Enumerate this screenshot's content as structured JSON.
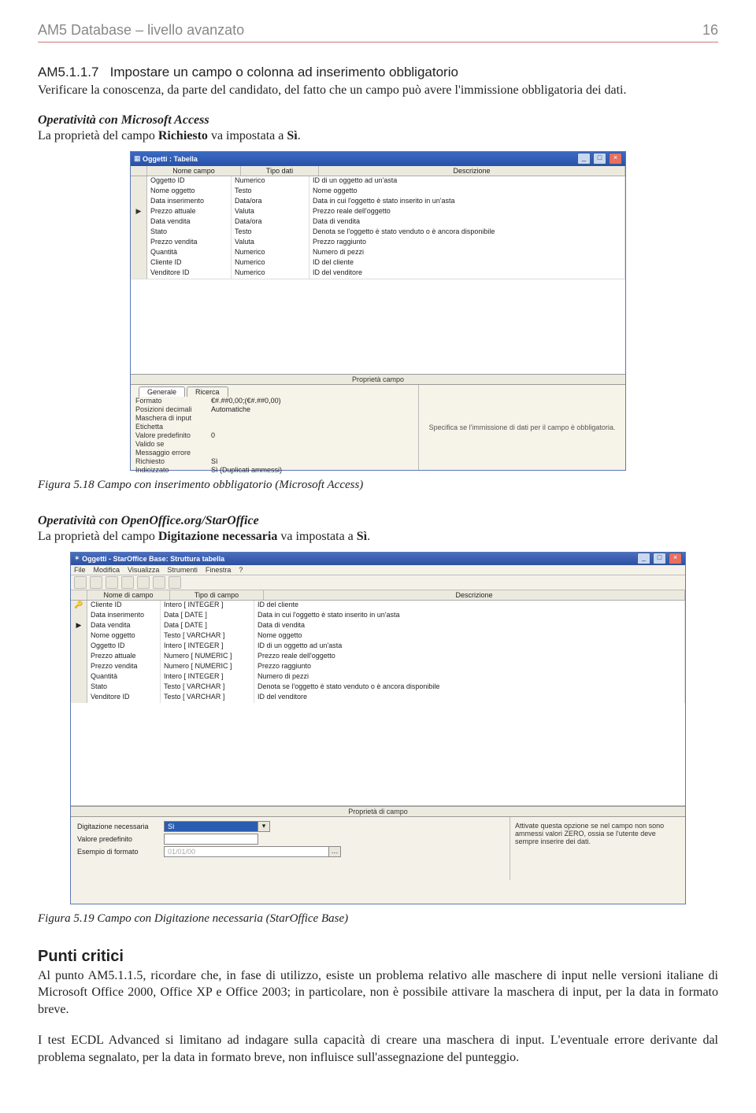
{
  "header": {
    "left": "AM5 Database – livello avanzato",
    "right": "16"
  },
  "section_num": "AM5.1.1.7",
  "section_title": "Impostare un campo o colonna ad inserimento obbligatorio",
  "intro": "Verificare la conoscenza, da parte del candidato, del fatto che un campo può avere l'immissione obbligatoria dei dati.",
  "op1_title": "Operatività con Microsoft Access",
  "op1_line_a": "La proprietà del campo ",
  "op1_bold": "Richiesto",
  "op1_line_b": " va impostata a ",
  "op1_bold2": "Sì",
  "op1_line_c": ".",
  "fig1_caption": "Figura 5.18 Campo con inserimento obbligatorio (Microsoft Access)",
  "op2_title": "Operatività con OpenOffice.org/StarOffice",
  "op2_line_a": "La proprietà del campo ",
  "op2_bold": "Digitazione necessaria",
  "op2_line_b": " va impostata a ",
  "op2_bold2": "Sì",
  "op2_line_c": ".",
  "fig2_caption": "Figura 5.19 Campo con Digitazione necessaria (StarOffice Base)",
  "punti_title": "Punti critici",
  "punti_p1": "Al punto AM5.1.1.5, ricordare che, in fase di utilizzo, esiste un problema relativo alle maschere di input nelle versioni italiane di Microsoft Office 2000, Office XP e Office 2003; in particolare, non è possibile attivare la maschera di input, per la data in formato breve.",
  "punti_p2": "I test ECDL Advanced si limitano ad indagare sulla capacità di creare una maschera di input. L'eventuale errore derivante dal problema segnalato, per la data in formato breve, non influisce sull'assegnazione del punteggio.",
  "access": {
    "title": "Oggetti : Tabella",
    "title_min": "_",
    "title_max": "□",
    "title_close": "×",
    "head": [
      "Nome campo",
      "Tipo dati",
      "Descrizione"
    ],
    "rows": [
      {
        "m": "",
        "n": "Oggetto ID",
        "t": "Numerico",
        "d": "ID di un oggetto ad un'asta"
      },
      {
        "m": "",
        "n": "Nome oggetto",
        "t": "Testo",
        "d": "Nome oggetto"
      },
      {
        "m": "",
        "n": "Data inserimento",
        "t": "Data/ora",
        "d": "Data in cui l'oggetto è stato inserito in un'asta"
      },
      {
        "m": "▶",
        "n": "Prezzo attuale",
        "t": "Valuta",
        "d": "Prezzo reale dell'oggetto"
      },
      {
        "m": "",
        "n": "Data vendita",
        "t": "Data/ora",
        "d": "Data di vendita"
      },
      {
        "m": "",
        "n": "Stato",
        "t": "Testo",
        "d": "Denota se l'oggetto è stato venduto o è ancora disponibile"
      },
      {
        "m": "",
        "n": "Prezzo vendita",
        "t": "Valuta",
        "d": "Prezzo raggiunto"
      },
      {
        "m": "",
        "n": "Quantità",
        "t": "Numerico",
        "d": "Numero di pezzi"
      },
      {
        "m": "",
        "n": "Cliente ID",
        "t": "Numerico",
        "d": "ID del cliente"
      },
      {
        "m": "",
        "n": "Venditore ID",
        "t": "Numerico",
        "d": "ID del venditore"
      }
    ],
    "propbar": "Proprietà campo",
    "tab1": "Generale",
    "tab2": "Ricerca",
    "props": [
      {
        "l": "Formato",
        "v": "€#.##0,00;(€#.##0,00)"
      },
      {
        "l": "Posizioni decimali",
        "v": "Automatiche"
      },
      {
        "l": "Maschera di input",
        "v": ""
      },
      {
        "l": "Etichetta",
        "v": ""
      },
      {
        "l": "Valore predefinito",
        "v": "0"
      },
      {
        "l": "Valido se",
        "v": ""
      },
      {
        "l": "Messaggio errore",
        "v": ""
      },
      {
        "l": "Richiesto",
        "v": "Sì"
      },
      {
        "l": "Indicizzato",
        "v": "Sì (Duplicati ammessi)"
      }
    ],
    "help": "Specifica se l'immissione di dati per il campo è obbligatoria."
  },
  "star": {
    "title": "Oggetti - StarOffice Base: Struttura tabella",
    "menu": [
      "File",
      "Modifica",
      "Visualizza",
      "Strumenti",
      "Finestra",
      "?"
    ],
    "head": [
      "Nome di campo",
      "Tipo di campo",
      "Descrizione"
    ],
    "rows": [
      {
        "m": "🔑",
        "n": "Cliente ID",
        "t": "Intero [ INTEGER ]",
        "d": "ID del cliente"
      },
      {
        "m": "",
        "n": "Data inserimento",
        "t": "Data [ DATE ]",
        "d": "Data in cui l'oggetto è stato inserito in un'asta"
      },
      {
        "m": "▶",
        "n": "Data vendita",
        "t": "Data [ DATE ]",
        "d": "Data di vendita"
      },
      {
        "m": "",
        "n": "Nome oggetto",
        "t": "Testo [ VARCHAR ]",
        "d": "Nome oggetto"
      },
      {
        "m": "",
        "n": "Oggetto ID",
        "t": "Intero [ INTEGER ]",
        "d": "ID di un oggetto ad un'asta"
      },
      {
        "m": "",
        "n": "Prezzo attuale",
        "t": "Numero [ NUMERIC ]",
        "d": "Prezzo reale dell'oggetto"
      },
      {
        "m": "",
        "n": "Prezzo vendita",
        "t": "Numero [ NUMERIC ]",
        "d": "Prezzo raggiunto"
      },
      {
        "m": "",
        "n": "Quantità",
        "t": "Intero [ INTEGER ]",
        "d": "Numero di pezzi"
      },
      {
        "m": "",
        "n": "Stato",
        "t": "Testo [ VARCHAR ]",
        "d": "Denota se l'oggetto è stato venduto o è ancora disponibile"
      },
      {
        "m": "",
        "n": "Venditore ID",
        "t": "Testo [ VARCHAR ]",
        "d": "ID del venditore"
      }
    ],
    "propbar": "Proprietà di campo",
    "p1_l": "Digitazione necessaria",
    "p1_v": "Sì",
    "dd": "▾",
    "p2_l": "Valore predefinito",
    "p2_v": "",
    "p3_l": "Esempio di formato",
    "p3_v": "01/01/00",
    "help": "Attivate questa opzione se nel campo non sono ammessi valori ZERO, ossia se l'utente deve sempre inserire dei dati."
  }
}
